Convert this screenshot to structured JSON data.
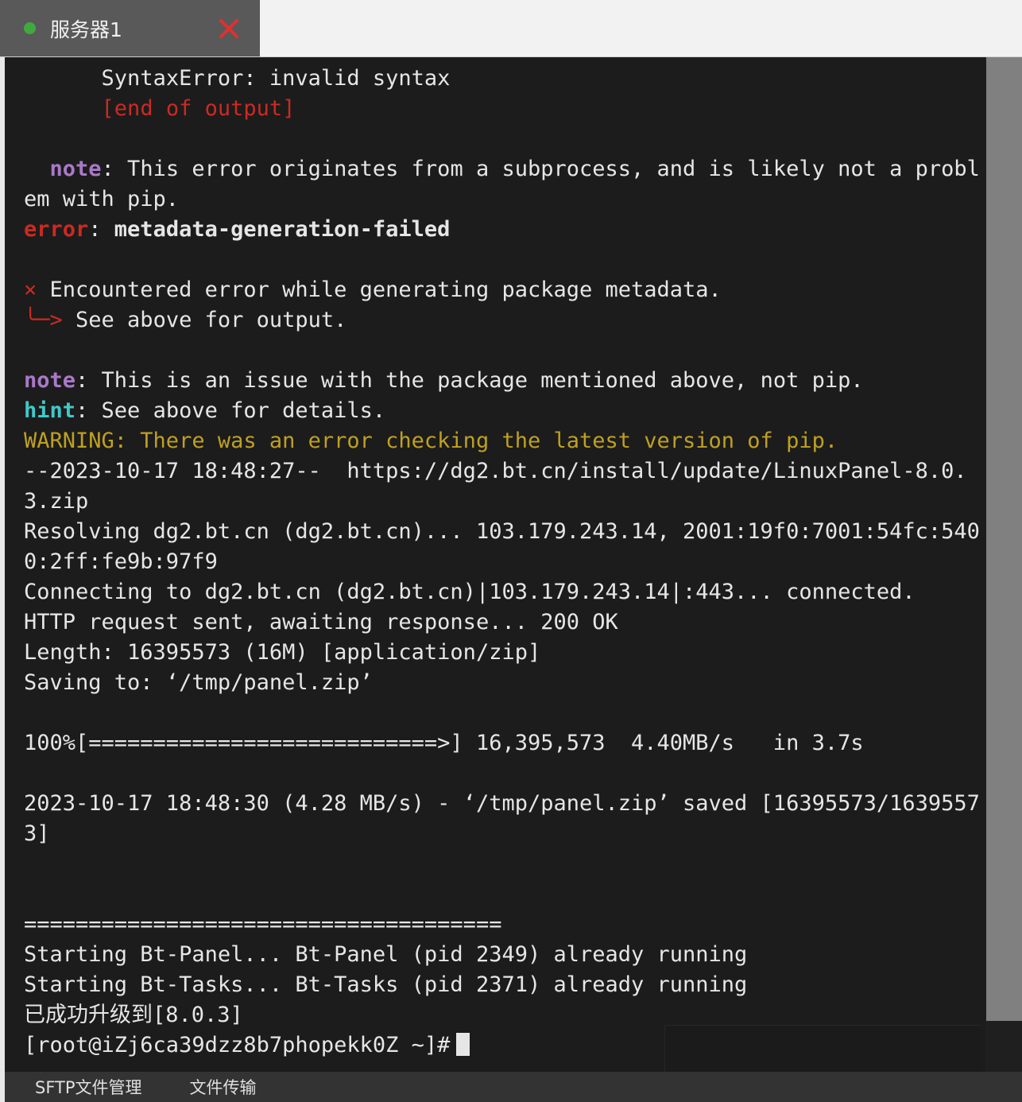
{
  "window": {
    "tab": {
      "label": "服务器1",
      "status_dot_color": "#3fa93f",
      "close_label": "×"
    }
  },
  "terminal": {
    "background_color": "#1c1c1c",
    "foreground_color": "#e6e6e6",
    "colors": {
      "red": "#cc2a22",
      "purple": "#a979c9",
      "cyan": "#3fc9c9",
      "yellow": "#bfa020",
      "white": "#e6e6e6"
    },
    "lines": [
      {
        "id": 0,
        "segments": [
          {
            "text": "      SyntaxError: invalid syntax",
            "color": "white"
          }
        ]
      },
      {
        "id": 1,
        "segments": [
          {
            "text": "      [end of output]",
            "color": "red"
          }
        ]
      },
      {
        "id": 2,
        "segments": [
          {
            "text": "",
            "color": "white"
          }
        ]
      },
      {
        "id": 3,
        "segments": [
          {
            "text": "  ",
            "color": "white"
          },
          {
            "text": "note",
            "color": "purple",
            "bold": true
          },
          {
            "text": ": This error originates from a subprocess, and is likely not a problem with pip.",
            "color": "white"
          }
        ]
      },
      {
        "id": 4,
        "segments": [
          {
            "text": "error",
            "color": "red",
            "bold": true
          },
          {
            "text": ": ",
            "color": "white"
          },
          {
            "text": "metadata-generation-failed",
            "color": "white",
            "bold": true
          }
        ]
      },
      {
        "id": 5,
        "segments": [
          {
            "text": "",
            "color": "white"
          }
        ]
      },
      {
        "id": 6,
        "segments": [
          {
            "text": "× ",
            "color": "red"
          },
          {
            "text": "Encountered error while generating package metadata.",
            "color": "white"
          }
        ]
      },
      {
        "id": 7,
        "segments": [
          {
            "text": "╰─> ",
            "color": "red"
          },
          {
            "text": "See above for output.",
            "color": "white"
          }
        ]
      },
      {
        "id": 8,
        "segments": [
          {
            "text": "",
            "color": "white"
          }
        ]
      },
      {
        "id": 9,
        "segments": [
          {
            "text": "note",
            "color": "purple",
            "bold": true
          },
          {
            "text": ": This is an issue with the package mentioned above, not pip.",
            "color": "white"
          }
        ]
      },
      {
        "id": 10,
        "segments": [
          {
            "text": "hint",
            "color": "cyan",
            "bold": true
          },
          {
            "text": ": See above for details.",
            "color": "white"
          }
        ]
      },
      {
        "id": 11,
        "segments": [
          {
            "text": "WARNING: There was an error checking the latest version of pip.",
            "color": "yellow"
          }
        ]
      },
      {
        "id": 12,
        "segments": [
          {
            "text": "--2023-10-17 18:48:27--  https://dg2.bt.cn/install/update/LinuxPanel-8.0.3.zip",
            "color": "white"
          }
        ]
      },
      {
        "id": 13,
        "segments": [
          {
            "text": "Resolving dg2.bt.cn (dg2.bt.cn)... 103.179.243.14, 2001:19f0:7001:54fc:5400:2ff:fe9b:97f9",
            "color": "white"
          }
        ]
      },
      {
        "id": 14,
        "segments": [
          {
            "text": "Connecting to dg2.bt.cn (dg2.bt.cn)|103.179.243.14|:443... connected.",
            "color": "white"
          }
        ]
      },
      {
        "id": 15,
        "segments": [
          {
            "text": "HTTP request sent, awaiting response... 200 OK",
            "color": "white"
          }
        ]
      },
      {
        "id": 16,
        "segments": [
          {
            "text": "Length: 16395573 (16M) [application/zip]",
            "color": "white"
          }
        ]
      },
      {
        "id": 17,
        "segments": [
          {
            "text": "Saving to: ‘/tmp/panel.zip’",
            "color": "white"
          }
        ]
      },
      {
        "id": 18,
        "segments": [
          {
            "text": "",
            "color": "white"
          }
        ]
      },
      {
        "id": 19,
        "segments": [
          {
            "text": "100%[===========================>] 16,395,573  4.40MB/s   in 3.7s",
            "color": "white"
          }
        ]
      },
      {
        "id": 20,
        "segments": [
          {
            "text": "",
            "color": "white"
          }
        ]
      },
      {
        "id": 21,
        "segments": [
          {
            "text": "2023-10-17 18:48:30 (4.28 MB/s) - ‘/tmp/panel.zip’ saved [16395573/16395573]",
            "color": "white"
          }
        ]
      },
      {
        "id": 22,
        "segments": [
          {
            "text": "",
            "color": "white"
          }
        ]
      },
      {
        "id": 23,
        "segments": [
          {
            "text": "",
            "color": "white"
          }
        ]
      },
      {
        "id": 24,
        "segments": [
          {
            "text": "=====================================",
            "color": "white"
          }
        ]
      },
      {
        "id": 25,
        "segments": [
          {
            "text": "Starting Bt-Panel... Bt-Panel (pid 2349) already running",
            "color": "white"
          }
        ]
      },
      {
        "id": 26,
        "segments": [
          {
            "text": "Starting Bt-Tasks... Bt-Tasks (pid 2371) already running",
            "color": "white"
          }
        ]
      },
      {
        "id": 27,
        "segments": [
          {
            "text": "已成功升级到[8.0.3]",
            "color": "white"
          }
        ]
      }
    ],
    "prompt": "[root@iZj6ca39dzz8b7phopekk0Z ~]#"
  },
  "scrollbar": {
    "thumb_top_pct": 0,
    "thumb_height_pct": 95,
    "thumb_color": "#808080"
  },
  "bottombar": {
    "items": [
      {
        "label": "SFTP文件管理"
      },
      {
        "label": "文件传输"
      }
    ]
  }
}
